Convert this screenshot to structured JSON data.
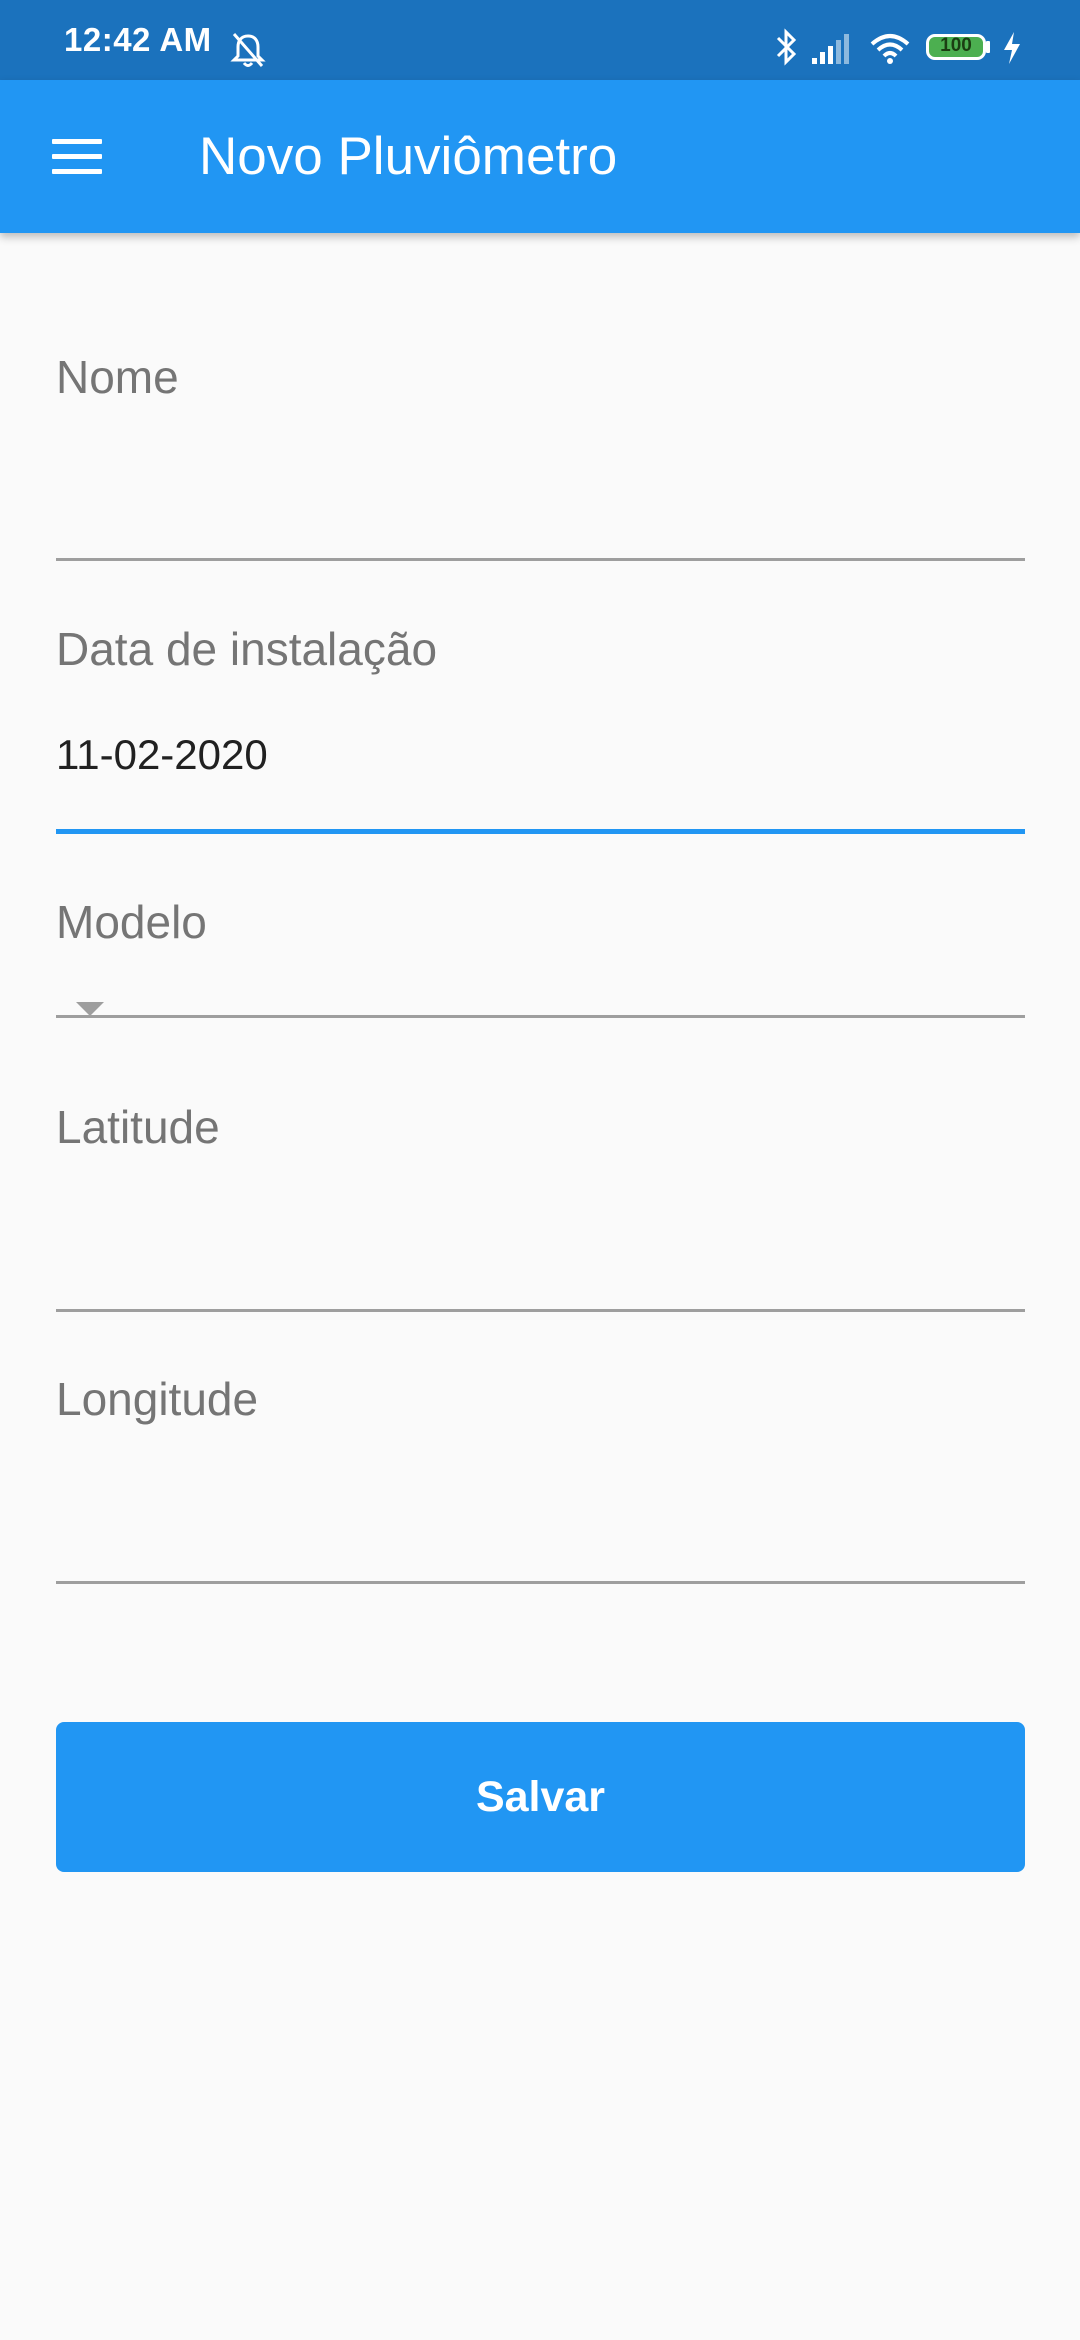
{
  "status_bar": {
    "time": "12:42 AM",
    "battery": "100",
    "icons": [
      "bell-off-icon",
      "bluetooth-icon",
      "signal-icon",
      "wifi-icon",
      "battery-icon",
      "charging-icon"
    ]
  },
  "app_bar": {
    "title": "Novo Pluviômetro",
    "menu_icon": "menu-icon"
  },
  "form": {
    "nome": {
      "label": "Nome",
      "value": ""
    },
    "data_instalacao": {
      "label": "Data de instalação",
      "value": "11-02-2020"
    },
    "modelo": {
      "label": "Modelo",
      "value": ""
    },
    "latitude": {
      "label": "Latitude",
      "value": ""
    },
    "longitude": {
      "label": "Longitude",
      "value": ""
    }
  },
  "save_label": "Salvar",
  "colors": {
    "primary": "#2196f3",
    "status_bar": "#1b72bd",
    "background": "#fafafa",
    "label": "#757575",
    "underline": "#9e9e9e",
    "battery": "#4caf50"
  }
}
